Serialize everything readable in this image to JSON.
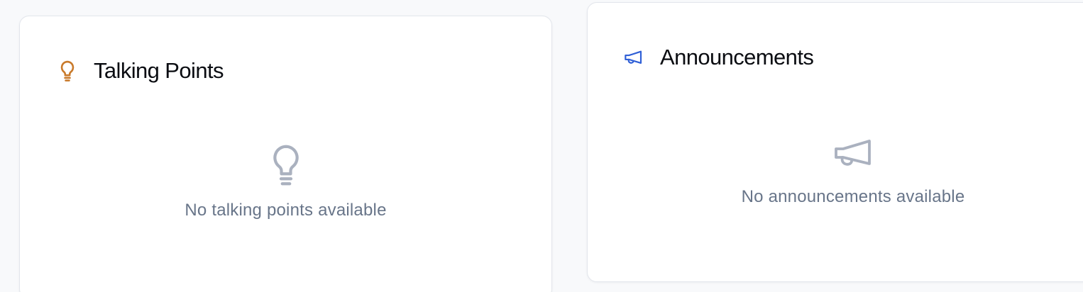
{
  "talking_points": {
    "title": "Talking Points",
    "header_icon": "lightbulb-icon",
    "empty_icon": "lightbulb-icon",
    "empty_message": "No talking points available",
    "accent_color": "#c97a2b"
  },
  "announcements": {
    "title": "Announcements",
    "header_icon": "megaphone-icon",
    "empty_icon": "megaphone-icon",
    "empty_message": "No announcements available",
    "accent_color": "#2f5fd6"
  },
  "colors": {
    "page_background": "#f8f9fb",
    "card_background": "#ffffff",
    "card_border": "#e3e6ec",
    "title_text": "#0b0d12",
    "empty_text": "#687589",
    "empty_icon": "#aab1bf"
  }
}
